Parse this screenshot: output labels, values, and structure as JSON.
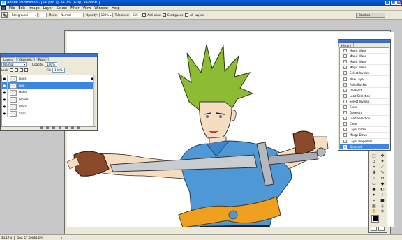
{
  "window": {
    "title": "Adobe Photoshop - [sai.psd @ 34.2% (Grip, RGB/8#)]",
    "controls": [
      "_",
      "□",
      "×"
    ]
  },
  "menu": [
    "File",
    "Edit",
    "Image",
    "Layer",
    "Select",
    "Filter",
    "View",
    "Window",
    "Help"
  ],
  "options": {
    "fill_source": "Foreground",
    "mode_label": "Mode:",
    "mode_value": "Normal",
    "opacity_label": "Opacity:",
    "opacity_value": "100%",
    "tolerance_label": "Tolerance:",
    "tolerance_value": "255",
    "anti_alias_label": "Anti-alias",
    "contiguous_label": "Contiguous",
    "all_layers_label": "All Layers",
    "brushes_tab": "Brushes"
  },
  "layers_panel": {
    "tabs": [
      "Layers",
      "Channels",
      "Paths"
    ],
    "blend_mode": "Normal",
    "opacity_label": "Opacity:",
    "opacity_value": "100%",
    "lock_label": "Lock:",
    "fill_label": "Fill:",
    "fill_value": "100%",
    "layers": [
      {
        "name": "Lines",
        "visible": true,
        "locked": true,
        "selected": false
      },
      {
        "name": "Grip",
        "visible": true,
        "locked": false,
        "selected": true
      },
      {
        "name": "Metal",
        "visible": true,
        "locked": false,
        "selected": false
      },
      {
        "name": "Gloves",
        "visible": true,
        "locked": false,
        "selected": false
      },
      {
        "name": "Pants",
        "visible": true,
        "locked": false,
        "selected": false
      },
      {
        "name": "Sash",
        "visible": true,
        "locked": false,
        "selected": false
      }
    ]
  },
  "history_panel": {
    "tabs": [
      "History"
    ],
    "items": [
      {
        "label": "Magic Wand",
        "selected": false
      },
      {
        "label": "Magic Wand",
        "selected": false
      },
      {
        "label": "Magic Wand",
        "selected": false
      },
      {
        "label": "Magic Wand",
        "selected": false
      },
      {
        "label": "Select Inverse",
        "selected": false
      },
      {
        "label": "New Layer",
        "selected": false
      },
      {
        "label": "Paint Bucket",
        "selected": false
      },
      {
        "label": "Deselect",
        "selected": false
      },
      {
        "label": "Load Selection",
        "selected": false
      },
      {
        "label": "Select Inverse",
        "selected": false
      },
      {
        "label": "Clear",
        "selected": false
      },
      {
        "label": "Deselect",
        "selected": false
      },
      {
        "label": "Load Selection",
        "selected": false
      },
      {
        "label": "Clear",
        "selected": false
      },
      {
        "label": "Layer Order",
        "selected": false
      },
      {
        "label": "Merge Down",
        "selected": false
      },
      {
        "label": "Layer Properties",
        "selected": false
      },
      {
        "label": "Deselect",
        "selected": true
      }
    ]
  },
  "status": {
    "zoom": "34.17%",
    "doc_size": "Doc: 17.6M/84.2M"
  },
  "colors": {
    "foreground": "#000000",
    "background": "#ffffff",
    "selection": "#3d85e5",
    "hair": "#8dbb33",
    "shirt": "#4f98d6",
    "sash": "#f0a020",
    "glove": "#8a4a2a"
  },
  "tools": [
    "marquee",
    "move",
    "lasso",
    "magic-wand",
    "crop",
    "slice",
    "healing",
    "brush",
    "stamp",
    "history-brush",
    "eraser",
    "paint-bucket",
    "blur",
    "dodge",
    "path-select",
    "type",
    "pen",
    "shape",
    "notes",
    "eyedropper",
    "hand",
    "zoom"
  ]
}
